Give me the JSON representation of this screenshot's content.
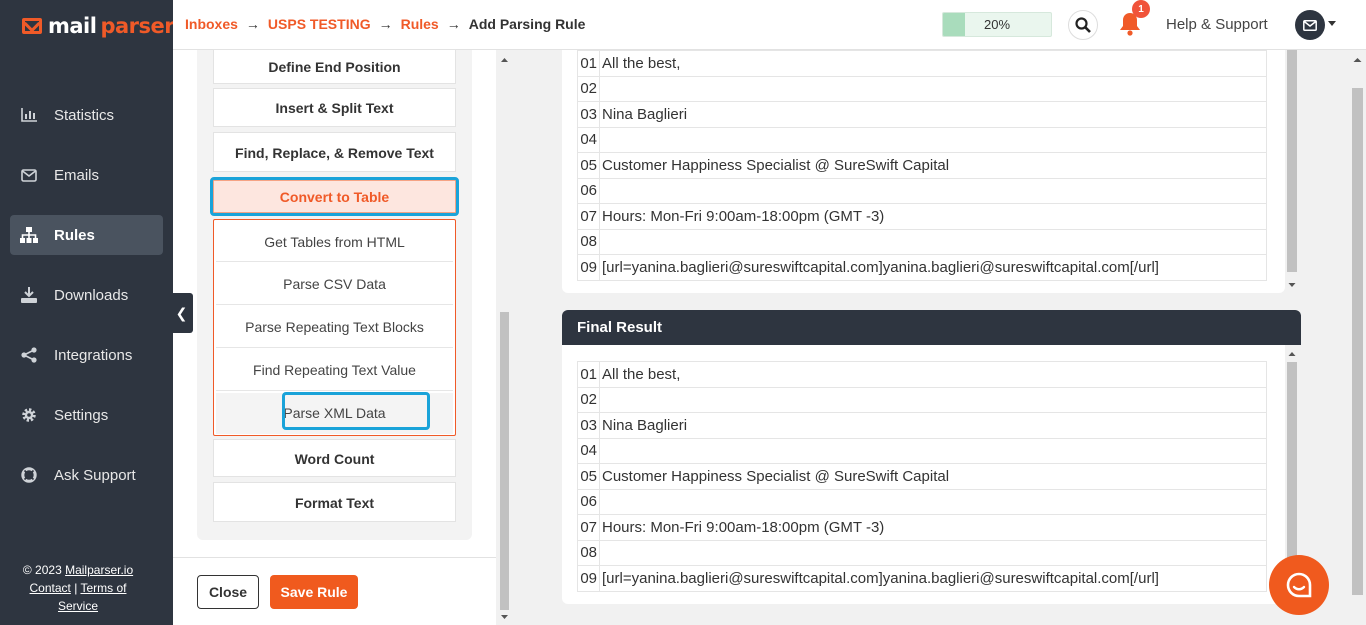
{
  "brand": {
    "part1": "mail",
    "part2": "parser"
  },
  "sidebar": {
    "items": [
      {
        "label": "Statistics",
        "icon": "chart-icon"
      },
      {
        "label": "Emails",
        "icon": "envelope-icon"
      },
      {
        "label": "Rules",
        "icon": "sitemap-icon",
        "active": true
      },
      {
        "label": "Downloads",
        "icon": "download-icon"
      },
      {
        "label": "Integrations",
        "icon": "share-icon"
      },
      {
        "label": "Settings",
        "icon": "gear-icon"
      },
      {
        "label": "Ask Support",
        "icon": "lifebuoy-icon"
      }
    ],
    "footer": {
      "copyright": "© 2023 ",
      "company": "Mailparser.io",
      "contact": "Contact",
      "sep": " | ",
      "terms": "Terms of Service"
    }
  },
  "breadcrumb": {
    "inboxes": "Inboxes",
    "inbox": "USPS TESTING",
    "rules": "Rules",
    "current": "Add Parsing Rule",
    "separator": "→"
  },
  "progress": {
    "label": "20%",
    "value": 0.2
  },
  "notifications": {
    "count": "1"
  },
  "help": {
    "label": "Help & Support"
  },
  "options": {
    "define_end": "Define End Position",
    "insert_split": "Insert & Split Text",
    "find_replace": "Find, Replace, & Remove Text",
    "convert_table": "Convert to Table",
    "sub": [
      "Get Tables from HTML",
      "Parse CSV Data",
      "Parse Repeating Text Blocks",
      "Find Repeating Text Value",
      "Parse XML Data"
    ],
    "word_count": "Word Count",
    "format_text": "Format Text"
  },
  "actions": {
    "close": "Close",
    "save": "Save Rule"
  },
  "lines": [
    {
      "n": "01",
      "text": "All the best,"
    },
    {
      "n": "02",
      "text": ""
    },
    {
      "n": "03",
      "text": "Nina Baglieri"
    },
    {
      "n": "04",
      "text": ""
    },
    {
      "n": "05",
      "text": "Customer Happiness Specialist @ SureSwift Capital"
    },
    {
      "n": "06",
      "text": ""
    },
    {
      "n": "07",
      "text": "Hours: Mon-Fri 9:00am-18:00pm (GMT -3)"
    },
    {
      "n": "08",
      "text": ""
    },
    {
      "n": "09",
      "text": "[url=yanina.baglieri@sureswiftcapital.com]yanina.baglieri@sureswiftcapital.com[/url]"
    }
  ],
  "final": {
    "title": "Final Result",
    "lines": [
      {
        "n": "01",
        "text": "All the best,"
      },
      {
        "n": "02",
        "text": ""
      },
      {
        "n": "03",
        "text": "Nina Baglieri"
      },
      {
        "n": "04",
        "text": ""
      },
      {
        "n": "05",
        "text": "Customer Happiness Specialist @ SureSwift Capital"
      },
      {
        "n": "06",
        "text": ""
      },
      {
        "n": "07",
        "text": "Hours: Mon-Fri 9:00am-18:00pm (GMT -3)"
      },
      {
        "n": "08",
        "text": ""
      },
      {
        "n": "09",
        "text": "[url=yanina.baglieri@sureswiftcapital.com]yanina.baglieri@sureswiftcapital.com[/url]"
      }
    ]
  },
  "colors": {
    "accent": "#f05a28",
    "sidebar": "#2e3540",
    "highlight": "#1aa3d9"
  }
}
